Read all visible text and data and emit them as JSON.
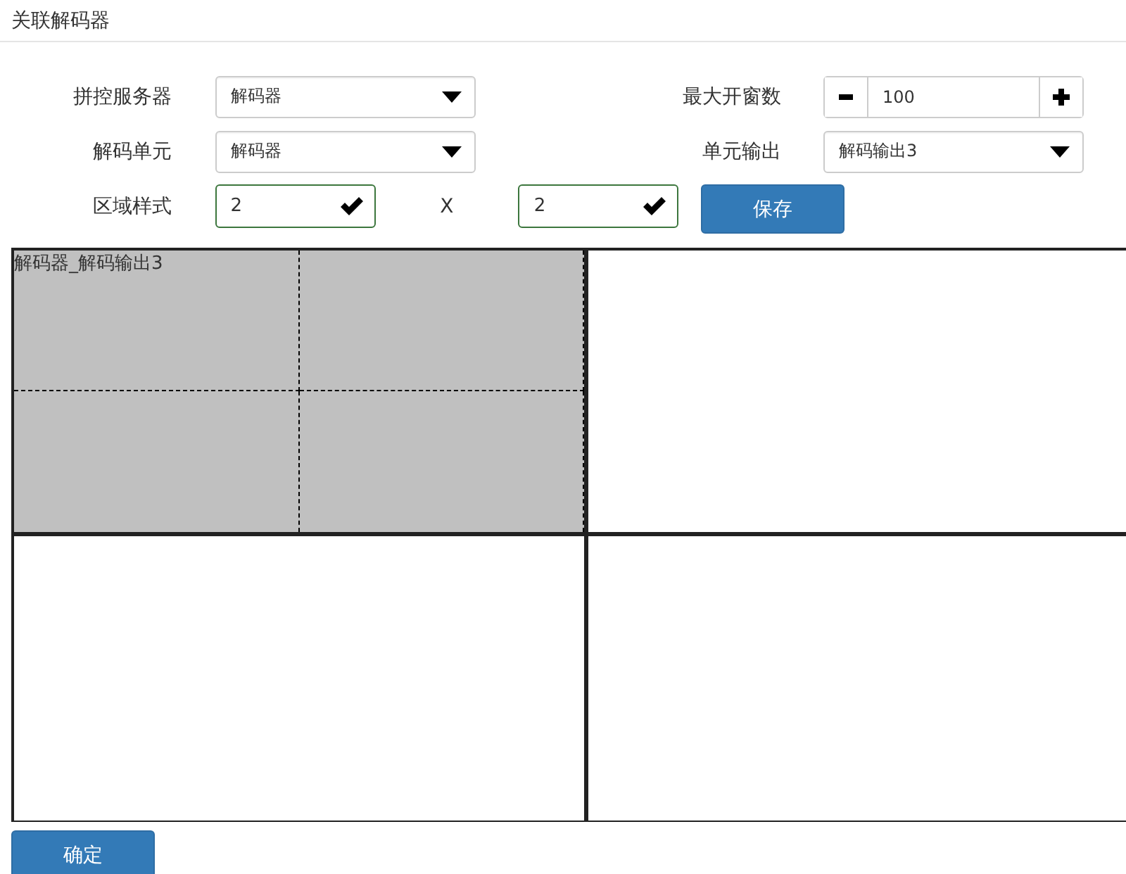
{
  "title": "关联解码器",
  "form": {
    "splice_server": {
      "label": "拼控服务器",
      "value": "解码器"
    },
    "max_windows": {
      "label": "最大开窗数",
      "value": "100"
    },
    "decode_unit": {
      "label": "解码单元",
      "value": "解码器"
    },
    "unit_output": {
      "label": "单元输出",
      "value": "解码输出3"
    },
    "region_style": {
      "label": "区域样式",
      "rows": "2",
      "separator": "X",
      "cols": "2"
    },
    "save": "保存"
  },
  "screens": [
    {
      "selected": true,
      "label": "解码器_解码输出3"
    },
    {
      "selected": false
    },
    {
      "selected": false
    },
    {
      "selected": false
    }
  ],
  "confirm": "确定"
}
